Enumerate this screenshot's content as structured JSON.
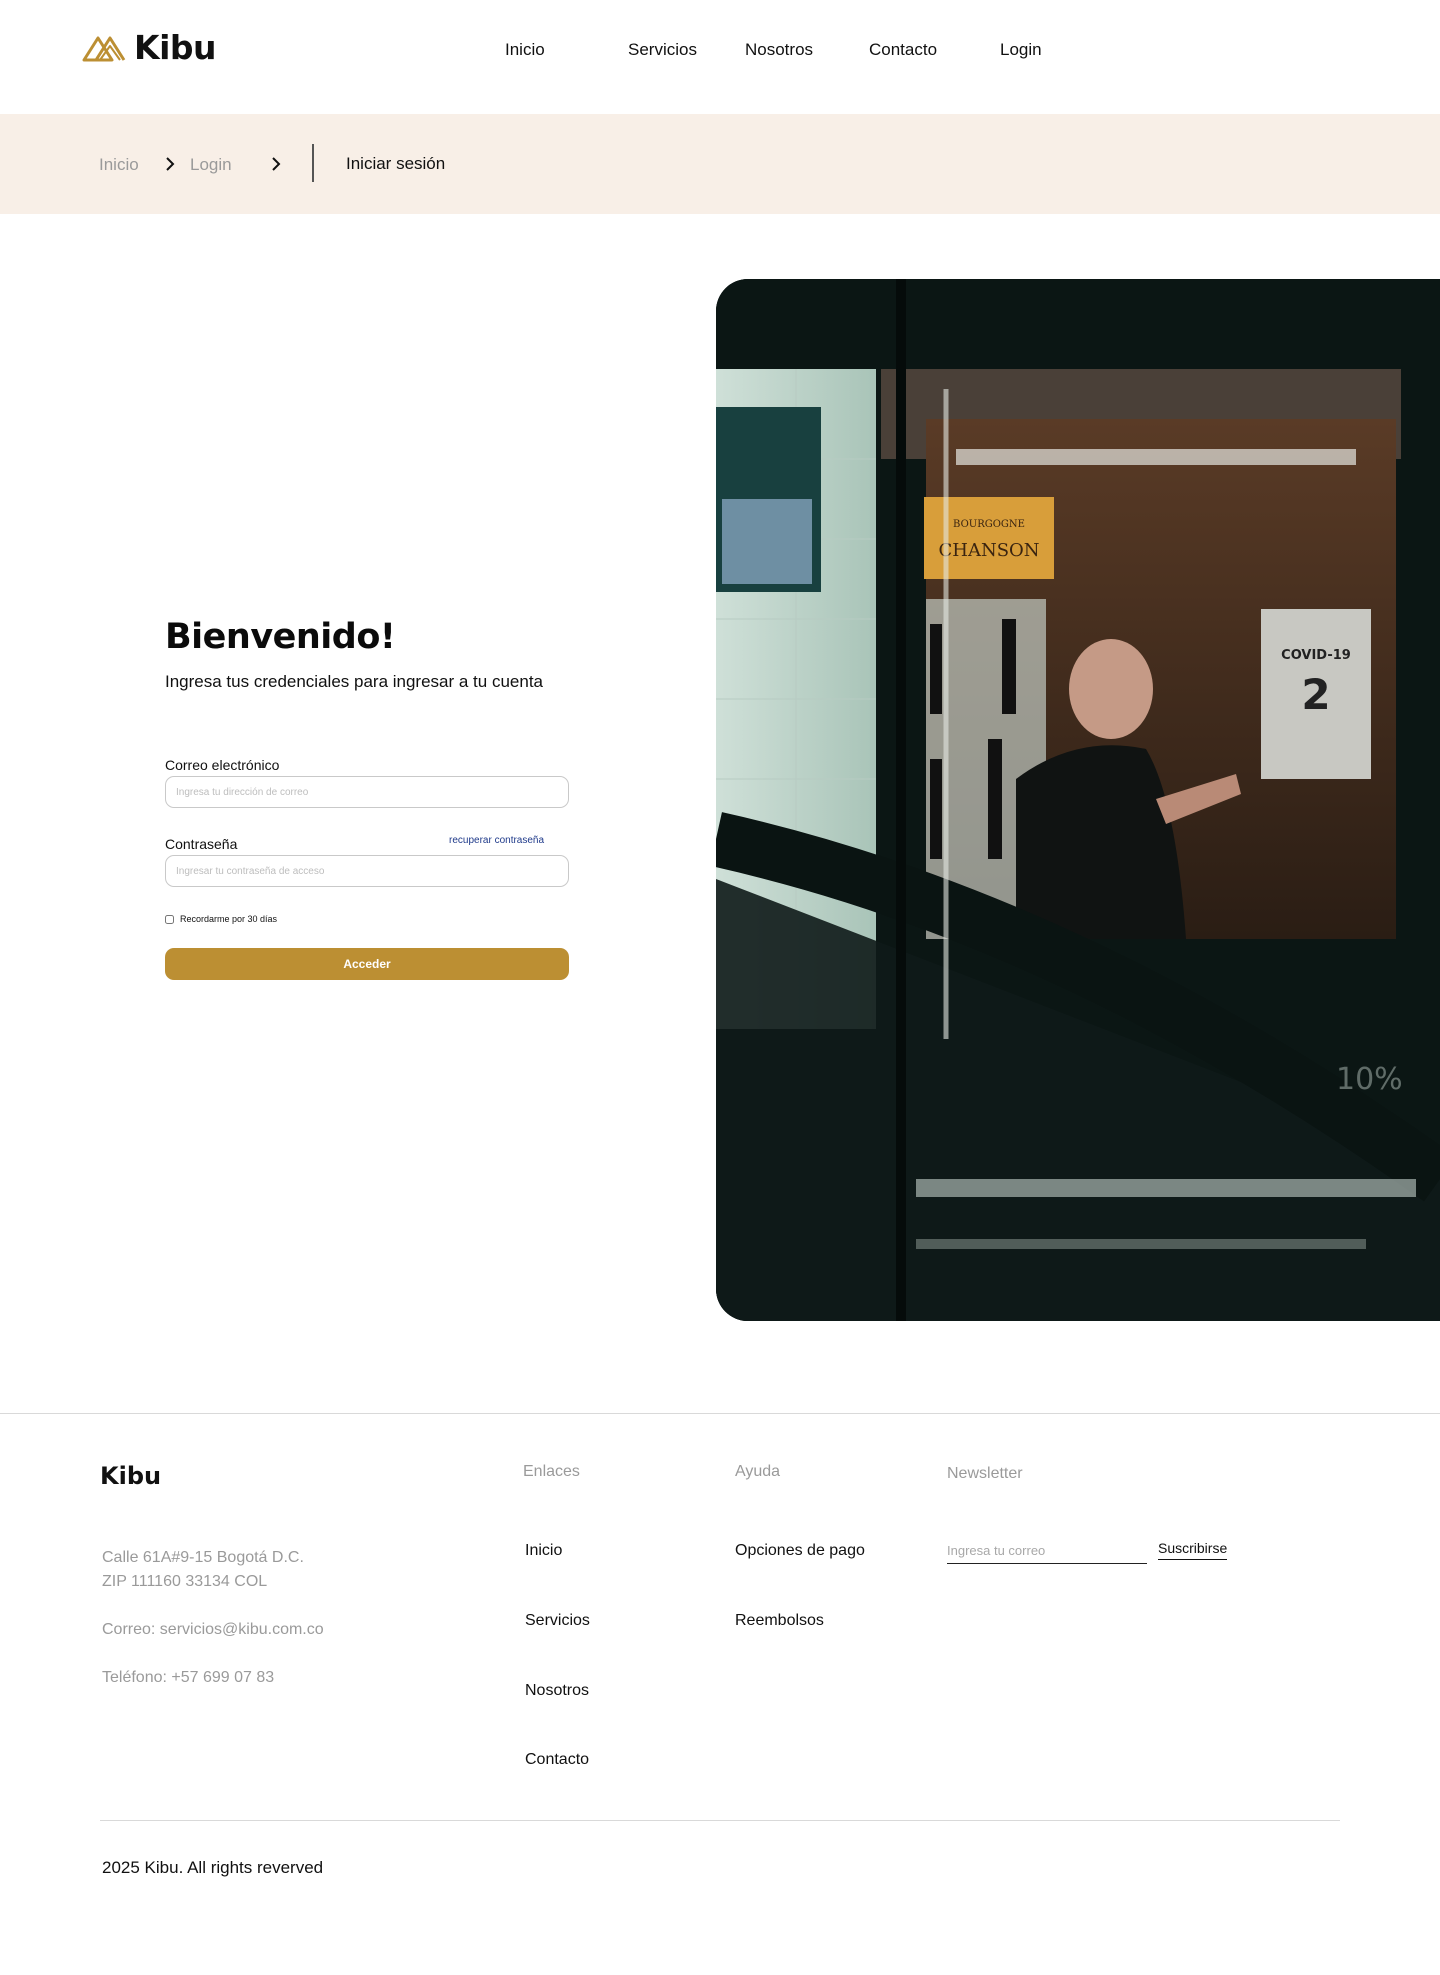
{
  "brand": {
    "name": "Kibu",
    "accent": "#bc8f33"
  },
  "nav": {
    "items": [
      "Inicio",
      "Servicios",
      "Nosotros",
      "Contacto",
      "Login"
    ]
  },
  "breadcrumb": {
    "items": [
      "Inicio",
      "Login"
    ],
    "current": "Iniciar sesión",
    "separator_icon": "chevron-right-icon"
  },
  "login": {
    "title": "Bienvenido!",
    "subtitle": "Ingresa tus credenciales para ingresar a tu cuenta",
    "email_label": "Correo electrónico",
    "email_placeholder": "Ingresa tu dirección de correo",
    "email_value": "",
    "password_label": "Contraseña",
    "password_placeholder": "Ingresar tu contraseña de acceso",
    "password_value": "",
    "forgot_link": "recuperar contraseña",
    "remember_label": "Recordarme por 30 días",
    "remember_checked": false,
    "submit_label": "Acceder"
  },
  "photo": {
    "sign_text": "CHANSON",
    "sign_top": "BOURGOGNE",
    "poster_text": "COVID-19",
    "price_tag": "10%"
  },
  "footer": {
    "logo": "Kibu",
    "address_line1": "Calle 61A#9-15 Bogotá D.C.",
    "address_line2": "ZIP 111160 33134 COL",
    "email": "Correo: servicios@kibu.com.co",
    "phone": "Teléfono: +57 699 07 83",
    "links_heading": "Enlaces",
    "links": [
      "Inicio",
      "Servicios",
      "Nosotros",
      "Contacto"
    ],
    "help_heading": "Ayuda",
    "help_links": [
      "Opciones de pago",
      "Reembolsos"
    ],
    "newsletter_heading": "Newsletter",
    "newsletter_placeholder": "Ingresa tu correo",
    "newsletter_button": "Suscribirse",
    "copyright": "2025 Kibu. All rights reverved"
  }
}
